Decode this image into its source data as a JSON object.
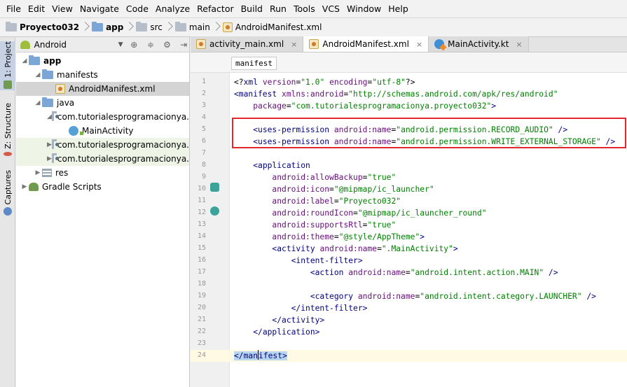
{
  "menu": [
    "File",
    "Edit",
    "View",
    "Navigate",
    "Code",
    "Analyze",
    "Refactor",
    "Build",
    "Run",
    "Tools",
    "VCS",
    "Window",
    "Help"
  ],
  "breadcrumb": [
    "Proyecto032",
    "app",
    "src",
    "main",
    "AndroidManifest.xml"
  ],
  "toolstrip": {
    "project": "1: Project",
    "structure": "Z: Structure",
    "captures": "Captures"
  },
  "project_panel": {
    "view": "Android",
    "tree": [
      {
        "label": "app",
        "depth": 0,
        "arrow": "▼",
        "icon": "folder",
        "bold": true
      },
      {
        "label": "manifests",
        "depth": 1,
        "arrow": "▼",
        "icon": "folder"
      },
      {
        "label": "AndroidManifest.xml",
        "depth": 2,
        "arrow": "",
        "icon": "xml",
        "selected": true
      },
      {
        "label": "java",
        "depth": 1,
        "arrow": "▼",
        "icon": "folder"
      },
      {
        "label": "com.tutorialesprogramacionya.",
        "depth": 2,
        "arrow": "▼",
        "icon": "package"
      },
      {
        "label": "MainActivity",
        "depth": 3,
        "arrow": "",
        "icon": "class"
      },
      {
        "label": "com.tutorialesprogramacionya.",
        "depth": 2,
        "arrow": "▶",
        "icon": "package",
        "tinted": true
      },
      {
        "label": "com.tutorialesprogramacionya.",
        "depth": 2,
        "arrow": "▶",
        "icon": "package",
        "tinted": true
      },
      {
        "label": "res",
        "depth": 1,
        "arrow": "▶",
        "icon": "res"
      },
      {
        "label": "Gradle Scripts",
        "depth": 0,
        "arrow": "▶",
        "icon": "gradle"
      }
    ]
  },
  "tabs": [
    {
      "label": "activity_main.xml",
      "icon": "xml",
      "active": false
    },
    {
      "label": "AndroidManifest.xml",
      "icon": "xml",
      "active": true
    },
    {
      "label": "MainActivity.kt",
      "icon": "kotlin",
      "active": false
    }
  ],
  "editor": {
    "context_chip": "manifest",
    "line_numbers": [
      "1",
      "2",
      "3",
      "4",
      "5",
      "6",
      "7",
      "8",
      "9",
      "10",
      "11",
      "12",
      "13",
      "14",
      "15",
      "16",
      "17",
      "18",
      "19",
      "20",
      "21",
      "22",
      "23",
      "24"
    ],
    "lines": [
      [
        [
          "p",
          "<?"
        ],
        [
          "t",
          "xml "
        ],
        [
          "a",
          "version"
        ],
        [
          "p",
          "="
        ],
        [
          "v",
          "\"1.0\""
        ],
        [
          "p",
          " "
        ],
        [
          "a",
          "encoding"
        ],
        [
          "p",
          "="
        ],
        [
          "v",
          "\"utf-8\""
        ],
        [
          "p",
          "?>"
        ]
      ],
      [
        [
          "t",
          "<manifest "
        ],
        [
          "a",
          "xmlns:android"
        ],
        [
          "p",
          "="
        ],
        [
          "v",
          "\"http://schemas.android.com/apk/res/android\""
        ]
      ],
      [
        [
          "p",
          "    "
        ],
        [
          "a",
          "package"
        ],
        [
          "p",
          "="
        ],
        [
          "v",
          "\"com.tutorialesprogramacionya.proyecto032\""
        ],
        [
          "t",
          ">"
        ]
      ],
      [],
      [
        [
          "p",
          "    "
        ],
        [
          "t",
          "<uses-permission "
        ],
        [
          "a",
          "android:name"
        ],
        [
          "p",
          "="
        ],
        [
          "v",
          "\"android.permission.RECORD_AUDIO\""
        ],
        [
          "t",
          " />"
        ]
      ],
      [
        [
          "p",
          "    "
        ],
        [
          "t",
          "<uses-permission "
        ],
        [
          "a",
          "android:name"
        ],
        [
          "p",
          "="
        ],
        [
          "v",
          "\"android.permission.WRITE_EXTERNAL_STORAGE\""
        ],
        [
          "t",
          " />"
        ]
      ],
      [],
      [
        [
          "p",
          "    "
        ],
        [
          "t",
          "<application"
        ]
      ],
      [
        [
          "p",
          "        "
        ],
        [
          "a",
          "android:allowBackup"
        ],
        [
          "p",
          "="
        ],
        [
          "v",
          "\"true\""
        ]
      ],
      [
        [
          "p",
          "        "
        ],
        [
          "a",
          "android:icon"
        ],
        [
          "p",
          "="
        ],
        [
          "v",
          "\"@mipmap/ic_launcher\""
        ]
      ],
      [
        [
          "p",
          "        "
        ],
        [
          "a",
          "android:label"
        ],
        [
          "p",
          "="
        ],
        [
          "v",
          "\"Proyecto032\""
        ]
      ],
      [
        [
          "p",
          "        "
        ],
        [
          "a",
          "android:roundIcon"
        ],
        [
          "p",
          "="
        ],
        [
          "v",
          "\"@mipmap/ic_launcher_round\""
        ]
      ],
      [
        [
          "p",
          "        "
        ],
        [
          "a",
          "android:supportsRtl"
        ],
        [
          "p",
          "="
        ],
        [
          "v",
          "\"true\""
        ]
      ],
      [
        [
          "p",
          "        "
        ],
        [
          "a",
          "android:theme"
        ],
        [
          "p",
          "="
        ],
        [
          "v",
          "\"@style/AppTheme\""
        ],
        [
          "t",
          ">"
        ]
      ],
      [
        [
          "p",
          "        "
        ],
        [
          "t",
          "<activity "
        ],
        [
          "a",
          "android:name"
        ],
        [
          "p",
          "="
        ],
        [
          "v",
          "\".MainActivity\""
        ],
        [
          "t",
          ">"
        ]
      ],
      [
        [
          "p",
          "            "
        ],
        [
          "t",
          "<intent-filter>"
        ]
      ],
      [
        [
          "p",
          "                "
        ],
        [
          "t",
          "<action "
        ],
        [
          "a",
          "android:name"
        ],
        [
          "p",
          "="
        ],
        [
          "v",
          "\"android.intent.action.MAIN\""
        ],
        [
          "t",
          " />"
        ]
      ],
      [],
      [
        [
          "p",
          "                "
        ],
        [
          "t",
          "<category "
        ],
        [
          "a",
          "android:name"
        ],
        [
          "p",
          "="
        ],
        [
          "v",
          "\"android.intent.category.LAUNCHER\""
        ],
        [
          "t",
          " />"
        ]
      ],
      [
        [
          "p",
          "            "
        ],
        [
          "t",
          "</intent-filter>"
        ]
      ],
      [
        [
          "p",
          "        "
        ],
        [
          "t",
          "</activity>"
        ]
      ],
      [
        [
          "p",
          "    "
        ],
        [
          "t",
          "</application>"
        ]
      ],
      [],
      [
        [
          "m",
          "</man"
        ],
        [
          "c",
          ""
        ],
        [
          "m",
          "ifest>"
        ]
      ]
    ]
  },
  "colors": {
    "tag": "#000080",
    "attribute": "#660e7a",
    "string": "#008000",
    "annotation_box": "#e3282e",
    "current_line": "#fffae3"
  }
}
